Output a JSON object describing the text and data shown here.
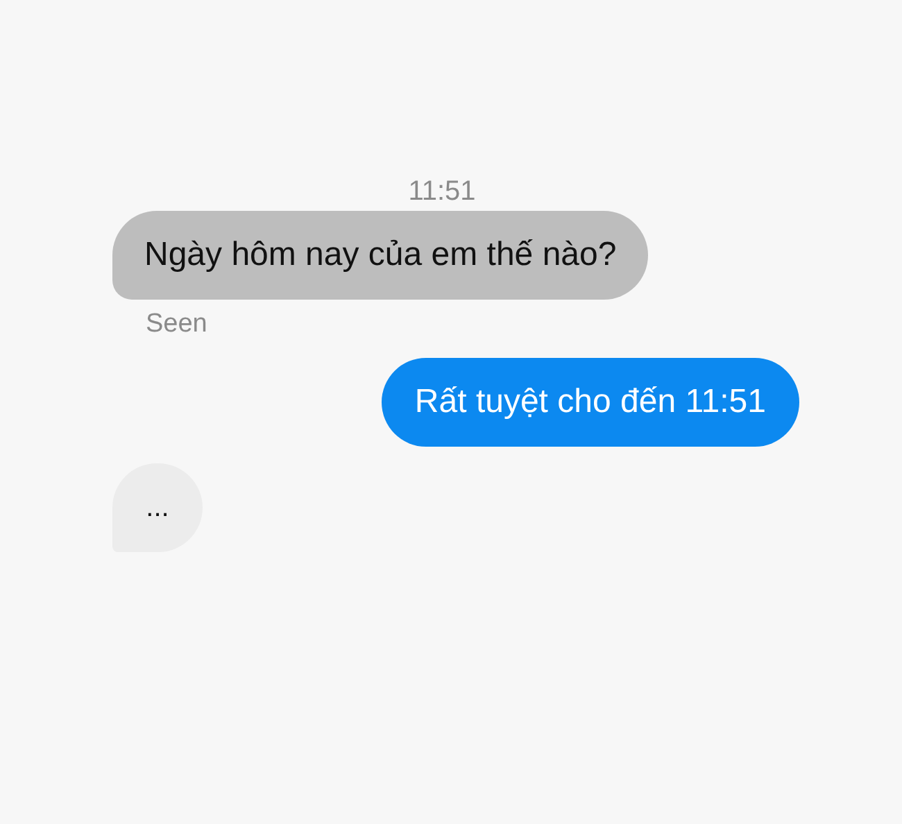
{
  "conversation": [
    {
      "kind": "timestamp",
      "text": "11:51"
    },
    {
      "kind": "incoming",
      "text": "Ngày hôm nay của em thế nào?"
    },
    {
      "kind": "receipt",
      "text": "Seen"
    },
    {
      "kind": "outgoing",
      "text": "Rất tuyệt cho đến 11:51"
    },
    {
      "kind": "typing",
      "text": "..."
    }
  ]
}
